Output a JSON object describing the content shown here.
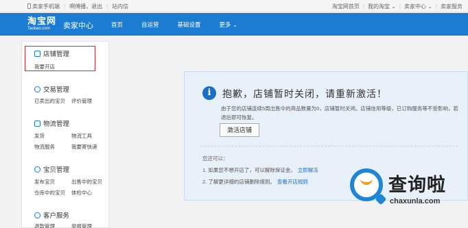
{
  "topbar": {
    "phone_link": "卖家手机端",
    "logout_link": "啊傅播，退出",
    "messages_link": "站内信",
    "right": [
      {
        "label": "淘宝网首页"
      },
      {
        "label": "我的淘宝 ⌄"
      },
      {
        "label": "卖家中心 ⌄"
      },
      {
        "label": "卖家服务"
      }
    ]
  },
  "nav": {
    "logo_cn": "淘宝网",
    "logo_en": "Taobao.com",
    "center_title": "卖家中心",
    "items": [
      {
        "label": "首页"
      },
      {
        "label": "自运营"
      },
      {
        "label": "基础设置"
      },
      {
        "label": "更多 ⌄"
      }
    ]
  },
  "sidebar": {
    "groups": [
      {
        "title": "店铺管理",
        "icon": "store-icon",
        "links": [
          "我要开店"
        ]
      },
      {
        "title": "交易管理",
        "icon": "trade-icon",
        "links": [
          "已卖出的宝贝",
          "评价管理"
        ]
      },
      {
        "title": "物流管理",
        "icon": "truck-icon",
        "links": [
          "发货",
          "物流工具",
          "物流服务",
          "我要寄快递"
        ]
      },
      {
        "title": "宝贝管理",
        "icon": "item-icon",
        "links": [
          "发布宝贝",
          "出售中的宝贝",
          "仓库中的宝贝",
          "体检中心"
        ]
      },
      {
        "title": "客户服务",
        "icon": "service-icon",
        "links": [
          "退款管理",
          "举报管理"
        ]
      }
    ]
  },
  "notice": {
    "title": "抱歉，店铺暂时关闭，请重新激活！",
    "desc": "由于您的店铺连续5周出售中的商品数量为0，店铺暂时关闭。店铺信用等级，已订购服务等不受影响，若退后即可恢复。",
    "activate_button": "激活店铺",
    "sub_title": "您还可以：",
    "tips": [
      {
        "text": "1. 如果您不想开店了，可以解除保证金。",
        "link": "立即解冻"
      },
      {
        "text": "2. 了解更详细的店铺删除规则。",
        "link": "查看开店规则"
      }
    ]
  },
  "watermark": {
    "cn": "查询啦",
    "en": "chaxunla.com"
  },
  "colors": {
    "brand_blue": "#1b7cd1",
    "highlight_red": "#d9262c",
    "notice_bg": "#e8f0f9"
  }
}
